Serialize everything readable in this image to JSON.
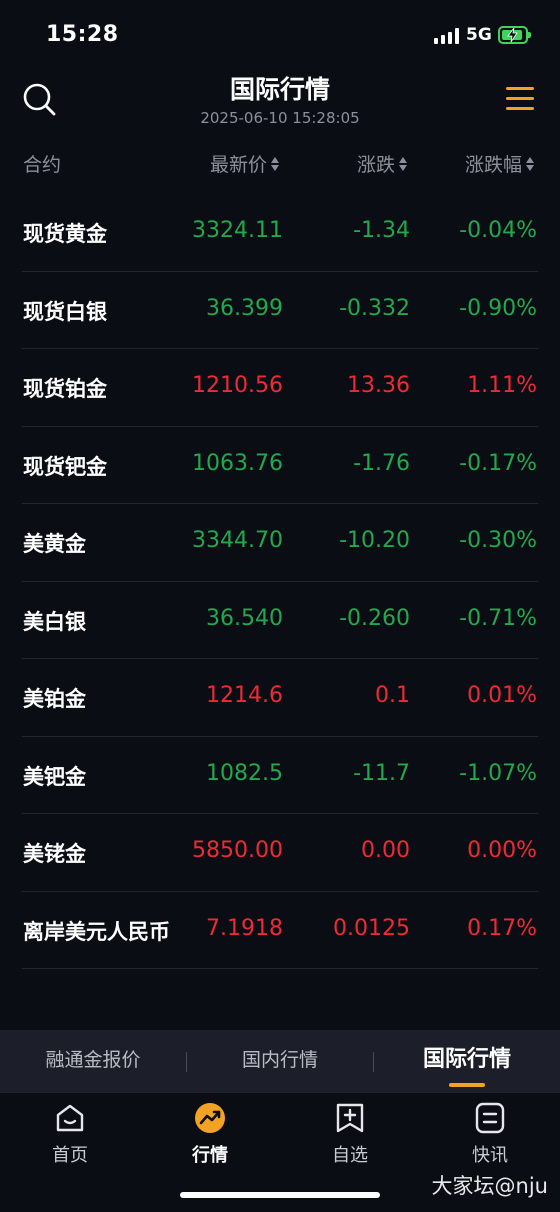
{
  "status_bar": {
    "time": "15:28",
    "network": "5G",
    "battery_color": "#3fd35b"
  },
  "header": {
    "title": "国际行情",
    "timestamp": "2025-06-10 15:28:05",
    "accent": "#f3a323"
  },
  "columns": {
    "name": "合约",
    "price": "最新价",
    "change": "涨跌",
    "pct": "涨跌幅"
  },
  "colors": {
    "up": "#ee2a34",
    "down": "#22a94d",
    "background": "#0b0d14"
  },
  "rows": [
    {
      "name": "现货黄金",
      "price": "3324.11",
      "change": "-1.34",
      "pct": "-0.04%",
      "trend": "down"
    },
    {
      "name": "现货白银",
      "price": "36.399",
      "change": "-0.332",
      "pct": "-0.90%",
      "trend": "down"
    },
    {
      "name": "现货铂金",
      "price": "1210.56",
      "change": "13.36",
      "pct": "1.11%",
      "trend": "up"
    },
    {
      "name": "现货钯金",
      "price": "1063.76",
      "change": "-1.76",
      "pct": "-0.17%",
      "trend": "down"
    },
    {
      "name": "美黄金",
      "price": "3344.70",
      "change": "-10.20",
      "pct": "-0.30%",
      "trend": "down"
    },
    {
      "name": "美白银",
      "price": "36.540",
      "change": "-0.260",
      "pct": "-0.71%",
      "trend": "down"
    },
    {
      "name": "美铂金",
      "price": "1214.6",
      "change": "0.1",
      "pct": "0.01%",
      "trend": "up"
    },
    {
      "name": "美钯金",
      "price": "1082.5",
      "change": "-11.7",
      "pct": "-1.07%",
      "trend": "down"
    },
    {
      "name": "美铑金",
      "price": "5850.00",
      "change": "0.00",
      "pct": "0.00%",
      "trend": "up"
    },
    {
      "name": "离岸美元人民币",
      "price": "7.1918",
      "change": "0.0125",
      "pct": "0.17%",
      "trend": "up"
    }
  ],
  "segments": [
    {
      "label": "融通金报价",
      "active": false
    },
    {
      "label": "国内行情",
      "active": false
    },
    {
      "label": "国际行情",
      "active": true
    }
  ],
  "nav": [
    {
      "label": "首页",
      "icon": "home-icon",
      "active": false
    },
    {
      "label": "行情",
      "icon": "market-icon",
      "active": true
    },
    {
      "label": "自选",
      "icon": "watchlist-icon",
      "active": false
    },
    {
      "label": "快讯",
      "icon": "news-icon",
      "active": false
    }
  ],
  "watermark": "大家坛@nju"
}
